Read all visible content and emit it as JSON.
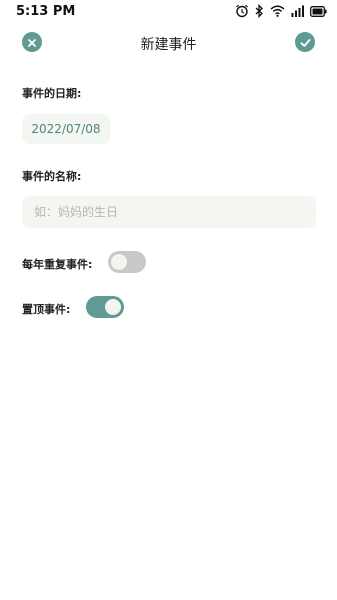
{
  "status_bar": {
    "time": "5:13 PM",
    "icons": [
      "alarm-icon",
      "bluetooth-icon",
      "wifi-icon",
      "signal-icon",
      "battery-icon"
    ]
  },
  "toolbar": {
    "title": "新建事件",
    "close_icon": "close-icon",
    "confirm_icon": "check-icon"
  },
  "form": {
    "date_label": "事件的日期:",
    "date_value": "2022/07/08",
    "name_label": "事件的名称:",
    "name_value": "",
    "name_placeholder": "如：妈妈的生日",
    "repeat_label": "每年重复事件:",
    "repeat_enabled": false,
    "pin_label": "置顶事件:",
    "pin_enabled": true
  },
  "colors": {
    "accent": "#5f9a95",
    "field_bg": "#f4f6f2",
    "toggle_off": "#c8c8c8"
  }
}
